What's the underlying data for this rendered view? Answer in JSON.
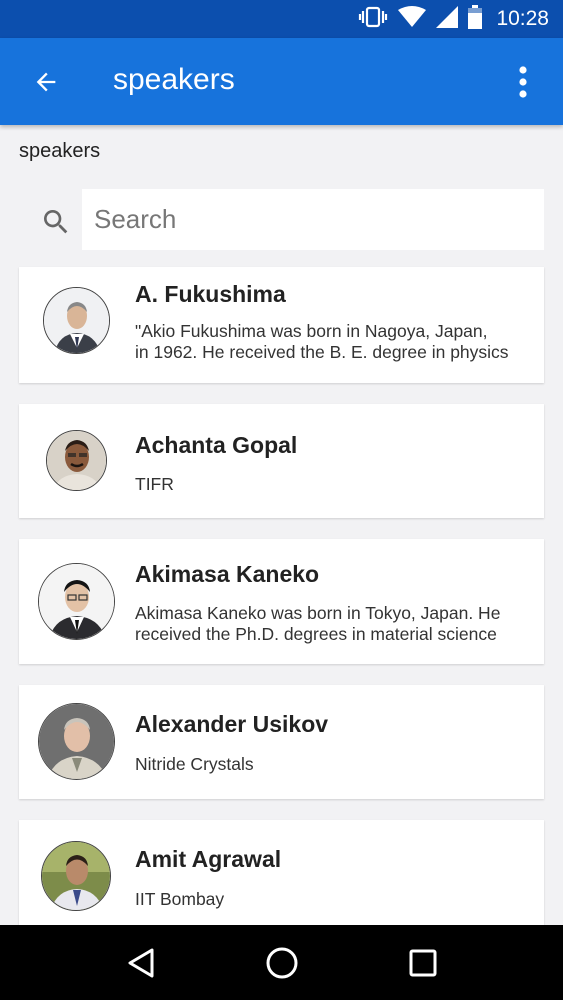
{
  "status_bar": {
    "time": "10:28"
  },
  "app_bar": {
    "title": "speakers"
  },
  "section_label": "speakers",
  "search": {
    "placeholder": "Search"
  },
  "speakers": [
    {
      "name": "A. Fukushima",
      "desc_line1": "\"Akio Fukushima was born in Nagoya, Japan,",
      "desc_line2": "in 1962.  He received the B. E. degree in physics"
    },
    {
      "name": "Achanta Gopal",
      "desc_line1": "TIFR"
    },
    {
      "name": "Akimasa Kaneko",
      "desc_line1": "Akimasa Kaneko was born in Tokyo, Japan. He",
      "desc_line2": "received the Ph.D. degrees in material science"
    },
    {
      "name": "Alexander Usikov",
      "desc_line1": "Nitride Crystals"
    },
    {
      "name": "Amit Agrawal",
      "desc_line1": "IIT Bombay"
    }
  ],
  "colors": {
    "status_bar": "#0c4fae",
    "app_bar": "#1773dc",
    "background": "#f2f2f4"
  }
}
